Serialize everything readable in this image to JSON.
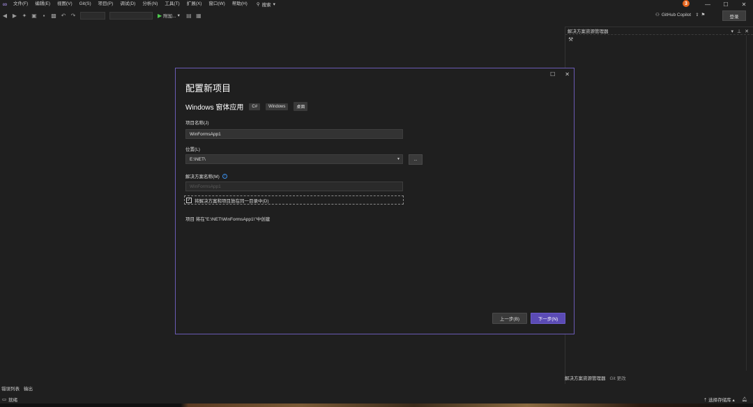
{
  "menubar": {
    "items": [
      "文件(F)",
      "编辑(E)",
      "视图(V)",
      "Git(S)",
      "项目(P)",
      "调试(D)",
      "分析(N)",
      "工具(T)",
      "扩展(X)",
      "窗口(W)",
      "帮助(H)"
    ],
    "search_label": "搜索",
    "notification_count": "3"
  },
  "toolbar": {
    "run_label": "附加...",
    "copilot_label": "GitHub Copilot",
    "signin_label": "登录"
  },
  "solution_explorer": {
    "title": "解决方案资源管理器",
    "tab_active": "解决方案资源管理器",
    "tab_git": "Git 更改"
  },
  "bottom_tabs": [
    "错误列表",
    "输出"
  ],
  "statusbar": {
    "ready_label": "就绪",
    "source_control_label": "选择存储库"
  },
  "dialog": {
    "title": "配置新项目",
    "template_name": "Windows 窗体应用",
    "tags": [
      "C#",
      "Windows",
      "桌面"
    ],
    "project_name_label": "项目名称(J)",
    "project_name_value": "WinFormsApp1",
    "location_label": "位置(L)",
    "location_value": "E:\\NET\\",
    "browse_label": "...",
    "solution_name_label": "解决方案名称(M)",
    "solution_name_placeholder": "WinFormsApp1",
    "checkbox_label": "将解决方案和项目放在同一目录中(D)",
    "checkbox_checked": true,
    "path_note": "项目 将在\"E:\\NET\\WinFormsApp1\\\"中创建",
    "back_label": "上一步(B)",
    "next_label": "下一步(N)"
  },
  "colors": {
    "accent": "#5b4bb5",
    "background": "#1f1f1f",
    "dialog_border": "#6b5bb5"
  }
}
